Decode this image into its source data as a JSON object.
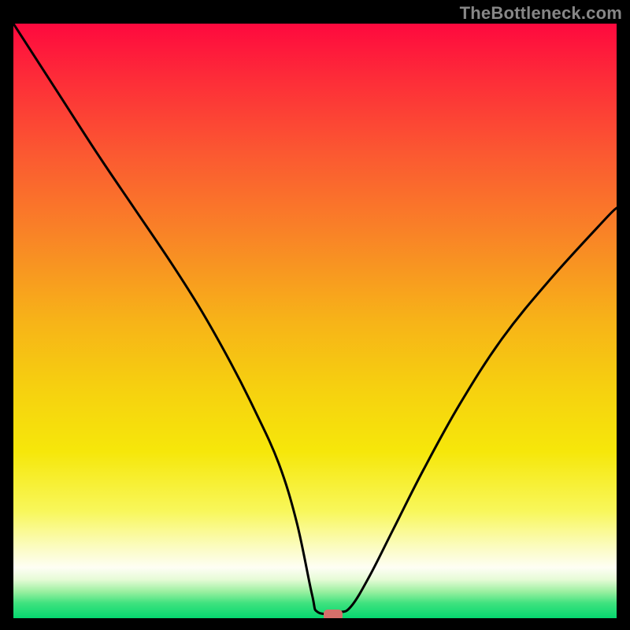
{
  "watermark": "TheBottleneck.com",
  "colors": {
    "frame_bg": "#000000",
    "watermark_text": "#878787",
    "curve_stroke": "#000000",
    "marker_fill": "#d6706b",
    "gradient_stops": [
      {
        "offset": 0.0,
        "color": "#fe093e"
      },
      {
        "offset": 0.1,
        "color": "#fd2f38"
      },
      {
        "offset": 0.22,
        "color": "#fb5931"
      },
      {
        "offset": 0.35,
        "color": "#f98227"
      },
      {
        "offset": 0.5,
        "color": "#f7b318"
      },
      {
        "offset": 0.62,
        "color": "#f6d20f"
      },
      {
        "offset": 0.72,
        "color": "#f6e70a"
      },
      {
        "offset": 0.82,
        "color": "#f8f75b"
      },
      {
        "offset": 0.88,
        "color": "#fbfcc0"
      },
      {
        "offset": 0.915,
        "color": "#fefef4"
      },
      {
        "offset": 0.935,
        "color": "#e6fbd6"
      },
      {
        "offset": 0.955,
        "color": "#9cf0a1"
      },
      {
        "offset": 0.975,
        "color": "#3ee27e"
      },
      {
        "offset": 1.0,
        "color": "#05d76f"
      }
    ]
  },
  "chart_data": {
    "type": "line",
    "title": "",
    "xlabel": "",
    "ylabel": "",
    "xlim": [
      0,
      100
    ],
    "ylim": [
      0,
      100
    ],
    "grid": false,
    "legend": false,
    "annotations": [],
    "marker": {
      "x": 53,
      "y": 0,
      "shape": "rounded-rect"
    },
    "series": [
      {
        "name": "curve",
        "x": [
          0,
          7,
          14,
          20,
          26,
          31,
          36,
          40,
          44,
          47,
          49.5,
          50.5,
          54,
          56,
          59,
          63,
          68,
          74,
          81,
          89,
          98,
          100
        ],
        "values": [
          100,
          89,
          78,
          69,
          60,
          52,
          43,
          35,
          26,
          16,
          4,
          1,
          1,
          2,
          7,
          15,
          25,
          36,
          47,
          57,
          67,
          69
        ]
      }
    ]
  }
}
